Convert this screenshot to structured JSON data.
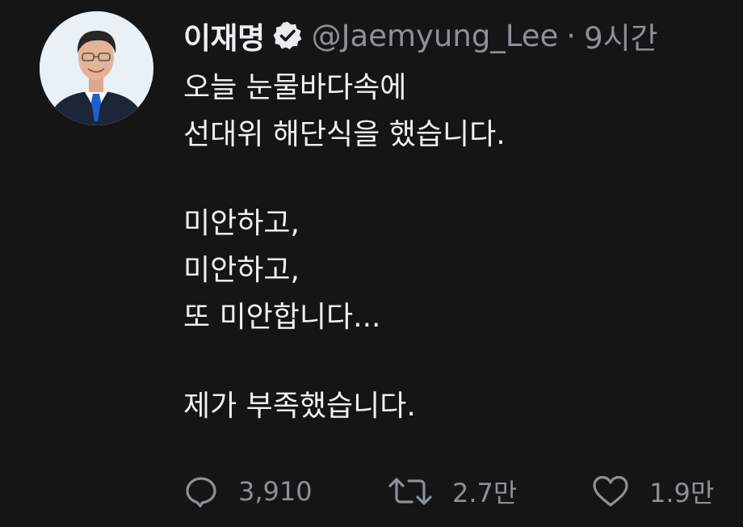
{
  "tweet": {
    "author": {
      "display_name": "이재명",
      "handle": "@Jaemyung_Lee",
      "verified": true
    },
    "separator": "·",
    "time": "9시간",
    "paragraphs": [
      [
        "오늘 눈물바다속에",
        "선대위 해단식을 했습니다."
      ],
      [
        "미안하고,",
        "미안하고,",
        "또 미안합니다..."
      ],
      [
        "제가 부족했습니다."
      ]
    ],
    "actions": {
      "reply": {
        "icon": "speech-bubble-icon",
        "count": "3,910"
      },
      "retweet": {
        "icon": "retweet-arrows-icon",
        "count": "2.7만"
      },
      "like": {
        "icon": "heart-icon",
        "count": "1.9만"
      }
    }
  },
  "colors": {
    "background": "#151515",
    "text": "#e7e9ea",
    "secondary_text": "#8b9196",
    "avatar_background": "#e9f0f6",
    "tie": "#1d5fd1"
  }
}
